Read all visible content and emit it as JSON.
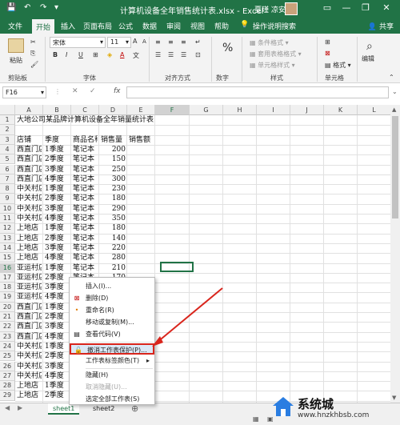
{
  "window": {
    "title": "计算机设备全年销售统计表.xlsx - Excel",
    "user": "夏瑾 凉安",
    "minimize": "—",
    "restore": "❐",
    "close": "✕"
  },
  "quick_access": {
    "save": "💾",
    "undo": "↶",
    "redo": "↷",
    "more": "▾"
  },
  "ribbon_tabs": [
    "文件",
    "开始",
    "插入",
    "页面布局",
    "公式",
    "数据",
    "审阅",
    "视图",
    "帮助",
    "操作说明搜索"
  ],
  "share_label": "共享",
  "ribbon": {
    "paste": "粘贴",
    "clipboard": "剪贴板",
    "font_name": "宋体",
    "font_size": "11",
    "font_group": "字体",
    "align_group": "对齐方式",
    "number_group": "数字",
    "percent": "%",
    "conditional_format": "条件格式",
    "table_format": "套用表格格式",
    "cell_style": "单元格样式",
    "styles_group": "样式",
    "cells": "单元格",
    "editing": "编辑",
    "cells_group": "单元格",
    "bold": "B",
    "italic": "I",
    "underline": "U",
    "font_grow": "A",
    "font_shrink": "A",
    "font_color": "A",
    "wen": "文"
  },
  "formula_bar": {
    "name_box": "F16",
    "fx": "fx"
  },
  "columns": [
    "A",
    "B",
    "C",
    "D",
    "E",
    "F",
    "G",
    "H",
    "I",
    "J",
    "K",
    "L"
  ],
  "rows": [
    "1",
    "2",
    "3",
    "4",
    "5",
    "6",
    "7",
    "8",
    "9",
    "10",
    "11",
    "12",
    "13",
    "14",
    "15",
    "16",
    "17",
    "18",
    "19",
    "20",
    "21",
    "22",
    "23",
    "24",
    "25",
    "26",
    "27",
    "28",
    "29"
  ],
  "sheet": {
    "title": "大地公司某品牌计算机设备全年销量统计表",
    "headers": [
      "店铺",
      "季度",
      "商品名称",
      "销售量",
      "销售额"
    ],
    "data": [
      [
        "西直门店",
        "1季度",
        "笔记本",
        "200"
      ],
      [
        "西直门店",
        "2季度",
        "笔记本",
        "150"
      ],
      [
        "西直门店",
        "3季度",
        "笔记本",
        "250"
      ],
      [
        "西直门店",
        "4季度",
        "笔记本",
        "300"
      ],
      [
        "中关村店",
        "1季度",
        "笔记本",
        "230"
      ],
      [
        "中关村店",
        "2季度",
        "笔记本",
        "180"
      ],
      [
        "中关村店",
        "3季度",
        "笔记本",
        "290"
      ],
      [
        "中关村店",
        "4季度",
        "笔记本",
        "350"
      ],
      [
        "上地店",
        "1季度",
        "笔记本",
        "180"
      ],
      [
        "上地店",
        "2季度",
        "笔记本",
        "140"
      ],
      [
        "上地店",
        "3季度",
        "笔记本",
        "220"
      ],
      [
        "上地店",
        "4季度",
        "笔记本",
        "280"
      ],
      [
        "亚运村店",
        "1季度",
        "笔记本",
        "210"
      ],
      [
        "亚运村店",
        "2季度",
        "笔记本",
        "170"
      ],
      [
        "亚运村店",
        "3季度",
        "",
        ""
      ],
      [
        "亚运村店",
        "4季度",
        "",
        ""
      ],
      [
        "西直门店",
        "1季度",
        "",
        ""
      ],
      [
        "西直门店",
        "2季度",
        "",
        ""
      ],
      [
        "西直门店",
        "3季度",
        "",
        ""
      ],
      [
        "西直门店",
        "4季度",
        "",
        ""
      ],
      [
        "中关村店",
        "1季度",
        "",
        ""
      ],
      [
        "中关村店",
        "2季度",
        "",
        ""
      ],
      [
        "中关村店",
        "3季度",
        "",
        ""
      ],
      [
        "中关村店",
        "4季度",
        "",
        ""
      ],
      [
        "上地店",
        "1季度",
        "",
        ""
      ],
      [
        "上地店",
        "2季度",
        "",
        ""
      ]
    ]
  },
  "sheet_tabs": [
    "sheet1",
    "sheet2"
  ],
  "context_menu": {
    "items": [
      {
        "label": "插入(I)...",
        "icon": "",
        "disabled": false
      },
      {
        "label": "删除(D)",
        "icon": "delete-icon",
        "disabled": false
      },
      {
        "label": "重命名(R)",
        "icon": "",
        "disabled": false
      },
      {
        "label": "移动或复制(M)...",
        "icon": "",
        "disabled": false
      },
      {
        "label": "查看代码(V)",
        "icon": "code-icon",
        "disabled": false
      },
      {
        "label": "撤消工作表保护(P)...",
        "icon": "unprotect-icon",
        "disabled": false
      },
      {
        "label": "工作表标签颜色(T)",
        "icon": "",
        "disabled": false
      },
      {
        "label": "隐藏(H)",
        "icon": "",
        "disabled": false
      },
      {
        "label": "取消隐藏(U)...",
        "icon": "",
        "disabled": true
      },
      {
        "label": "选定全部工作表(S)",
        "icon": "",
        "disabled": false
      }
    ],
    "submenu_arrow": "▸"
  },
  "watermark": {
    "brand": "系统城",
    "url": "www.hnzkhbsb.com"
  },
  "colors": {
    "excel_green": "#217346",
    "highlight_red": "#d9251c"
  }
}
